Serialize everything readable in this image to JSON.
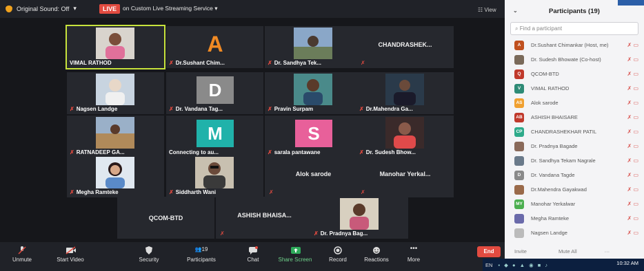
{
  "meeting": {
    "original_sound": "Original Sound: Off",
    "live_badge": "LIVE",
    "live_service": "on Custom Live Streaming Service",
    "view_label": "View"
  },
  "tiles": [
    {
      "name": "VIMAL RATHOD",
      "type": "video",
      "active": true
    },
    {
      "name": "Dr.Sushant Chim...",
      "type": "avatar-letter",
      "letter": "A"
    },
    {
      "name": "Dr. Sandhya Tek...",
      "type": "video"
    },
    {
      "name": "CHANDRASHEK...",
      "type": "name-only"
    },
    {
      "name": "Nagsen Landge",
      "type": "video"
    },
    {
      "name": "Dr. Vandana Tag...",
      "type": "avatar-letter",
      "letter": "D"
    },
    {
      "name": "Pravin Surpam",
      "type": "video"
    },
    {
      "name": "Dr.Mahendra Ga...",
      "type": "video"
    },
    {
      "name": "RATNADEEP GA...",
      "type": "video"
    },
    {
      "name": "Connecting to au...",
      "type": "avatar-letter",
      "letter": "M"
    },
    {
      "name": "sarala pantawane",
      "type": "avatar-letter",
      "letter": "S"
    },
    {
      "name": "Dr. Sudesh Bhow...",
      "type": "video"
    },
    {
      "name": "Megha Ramteke",
      "type": "video"
    },
    {
      "name": "Siddharth Wani",
      "type": "video"
    },
    {
      "name": "Alok sarode",
      "type": "name-only"
    },
    {
      "name": "Manohar Yerkal...",
      "type": "name-only"
    },
    {
      "name": "QCOM-BTD",
      "type": "name-only"
    },
    {
      "name": "ASHISH BHAISA...",
      "type": "name-only"
    },
    {
      "name": "Dr. Pradnya Bag...",
      "type": "video"
    }
  ],
  "toolbar": {
    "unmute": "Unmute",
    "start_video": "Start Video",
    "security": "Security",
    "participants": "Participants",
    "participants_count": "19",
    "chat": "Chat",
    "share_screen": "Share Screen",
    "record": "Record",
    "reactions": "Reactions",
    "more": "More",
    "end": "End"
  },
  "panel": {
    "title": "Participants (19)",
    "search_placeholder": "Find a participant",
    "participants": [
      {
        "initials": "A",
        "name": "Dr.Sushant Chimankar (Host, me)",
        "color": "#c0501e"
      },
      {
        "initials": "",
        "name": "Dr. Sudesh Bhowate (Co-host)",
        "color": "#7a6a5a"
      },
      {
        "initials": "Q",
        "name": "QCOM-BTD",
        "color": "#c0392b"
      },
      {
        "initials": "V",
        "name": "VIMAL RATHOD",
        "color": "#2e8b76"
      },
      {
        "initials": "AS",
        "name": "Alok sarode",
        "color": "#f0a030"
      },
      {
        "initials": "AB",
        "name": "ASHISH BHAISARE",
        "color": "#c0392b"
      },
      {
        "initials": "CP",
        "name": "CHANDRASHEKHAR PATIL",
        "color": "#2eaa8a"
      },
      {
        "initials": "",
        "name": "Dr. Pradnya Bagade",
        "color": "#8a6a5a"
      },
      {
        "initials": "",
        "name": "Dr. Sandhya Tekam Nagrale",
        "color": "#6a7a8a"
      },
      {
        "initials": "D",
        "name": "Dr. Vandana Tagde",
        "color": "#8a8a8a"
      },
      {
        "initials": "",
        "name": "Dr.Mahendra Gayakwad",
        "color": "#9a6a4a"
      },
      {
        "initials": "MY",
        "name": "Manohar Yerkalwar",
        "color": "#4caf50"
      },
      {
        "initials": "",
        "name": "Megha Ramteke",
        "color": "#6a6aaa"
      },
      {
        "initials": "",
        "name": "Nagsen Landge",
        "color": "#bbbbbb"
      }
    ],
    "invite": "Invite",
    "mute_all": "Mute All"
  },
  "taskbar": {
    "lang": "EN",
    "time": "10:32 AM"
  }
}
